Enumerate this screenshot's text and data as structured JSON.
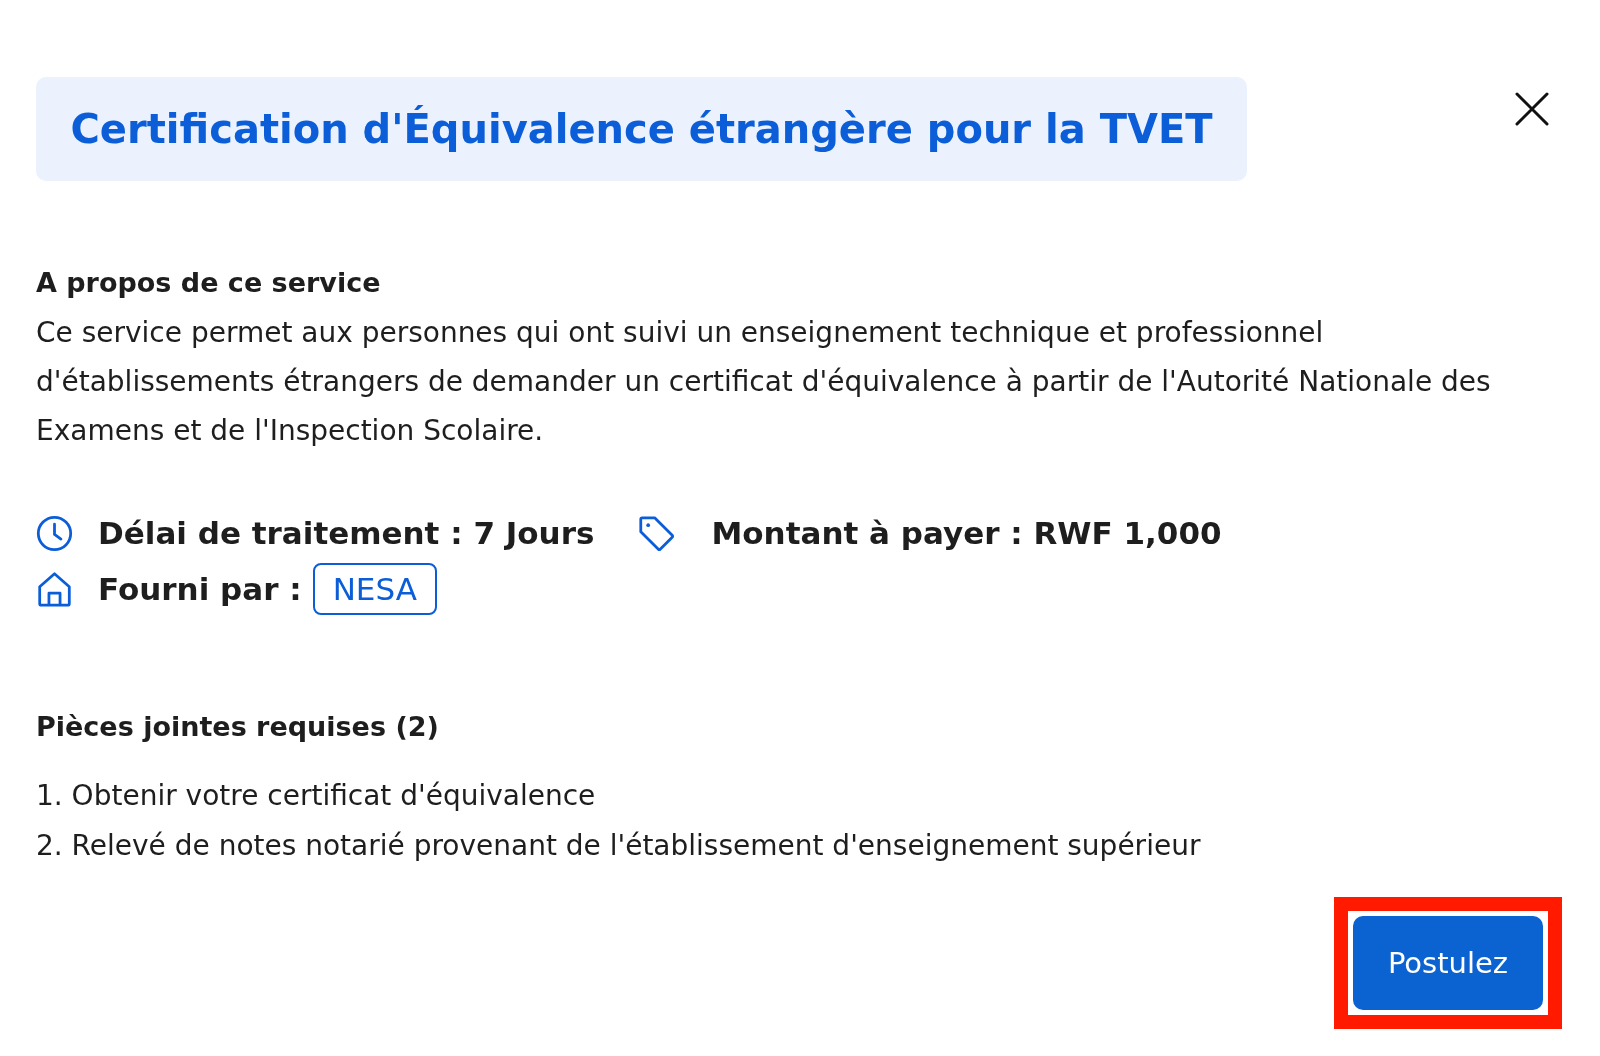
{
  "dialog": {
    "title": "Certification d'Équivalence étrangère pour la TVET"
  },
  "about": {
    "heading": "A propos de ce service",
    "text": "Ce service permet aux personnes qui ont suivi un enseignement technique et professionnel d'établissements étrangers de demander un certificat d'équivalence à partir de l'Autorité Nationale des Examens et de l'Inspection Scolaire."
  },
  "detail_rows": [
    {
      "items": [
        {
          "kind": "duration",
          "label": "Délai de traitement : 7 Jours"
        },
        {
          "kind": "fee",
          "label": "Montant à payer : RWF 1,000"
        }
      ]
    },
    {
      "items": [
        {
          "kind": "provider",
          "label": "Fourni par :",
          "badge": "NESA"
        }
      ]
    }
  ],
  "attachments": {
    "heading": "Pièces jointes requises (2)",
    "items": [
      "1. Obtenir votre certificat d'équivalence",
      "2. Relevé de notes notarié provenant de l'établissement d'enseignement supérieur"
    ]
  },
  "apply_button": {
    "label": "Postulez",
    "highlighted": true
  }
}
